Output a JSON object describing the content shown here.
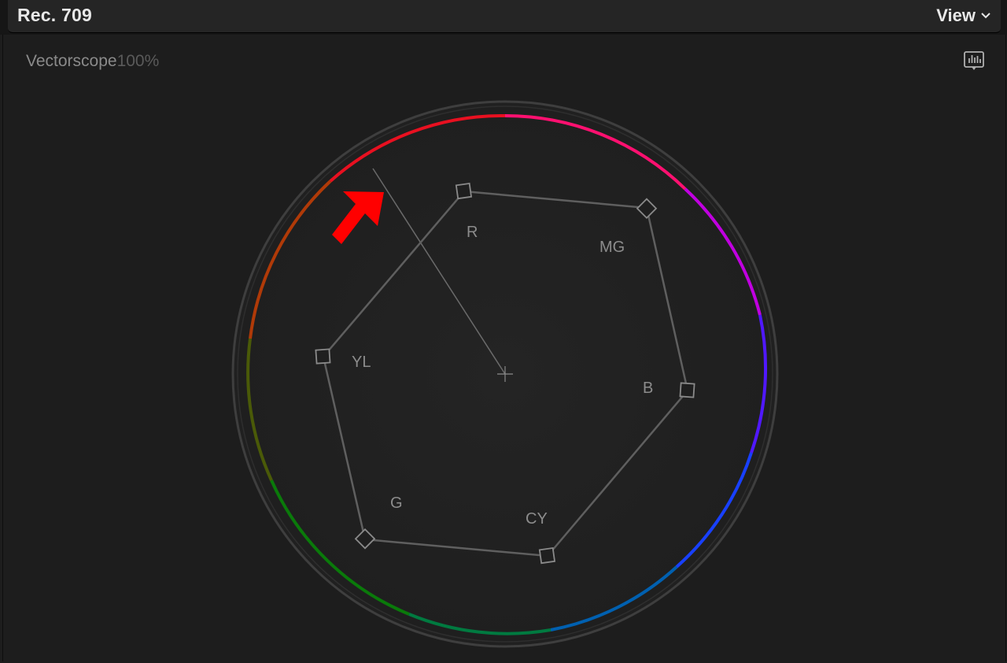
{
  "header": {
    "title": "Rec. 709",
    "view_label": "View"
  },
  "scope": {
    "name": "Vectorscope",
    "zoom": "100%",
    "targets": [
      {
        "id": "R",
        "label": "R"
      },
      {
        "id": "MG",
        "label": "MG"
      },
      {
        "id": "B",
        "label": "B"
      },
      {
        "id": "CY",
        "label": "CY"
      },
      {
        "id": "G",
        "label": "G"
      },
      {
        "id": "YL",
        "label": "YL"
      }
    ]
  },
  "colors": {
    "background": "#1d1d1d",
    "graticule": "#5f5f5f",
    "annotation_arrow": "#ff0000",
    "ring": [
      "#ff0000",
      "#ff0090",
      "#a000ff",
      "#2020ff",
      "#0070c0",
      "#008000",
      "#7a3a00"
    ]
  },
  "icons": {
    "view_menu": "chevron-down-icon",
    "settings": "scope-settings-icon"
  }
}
